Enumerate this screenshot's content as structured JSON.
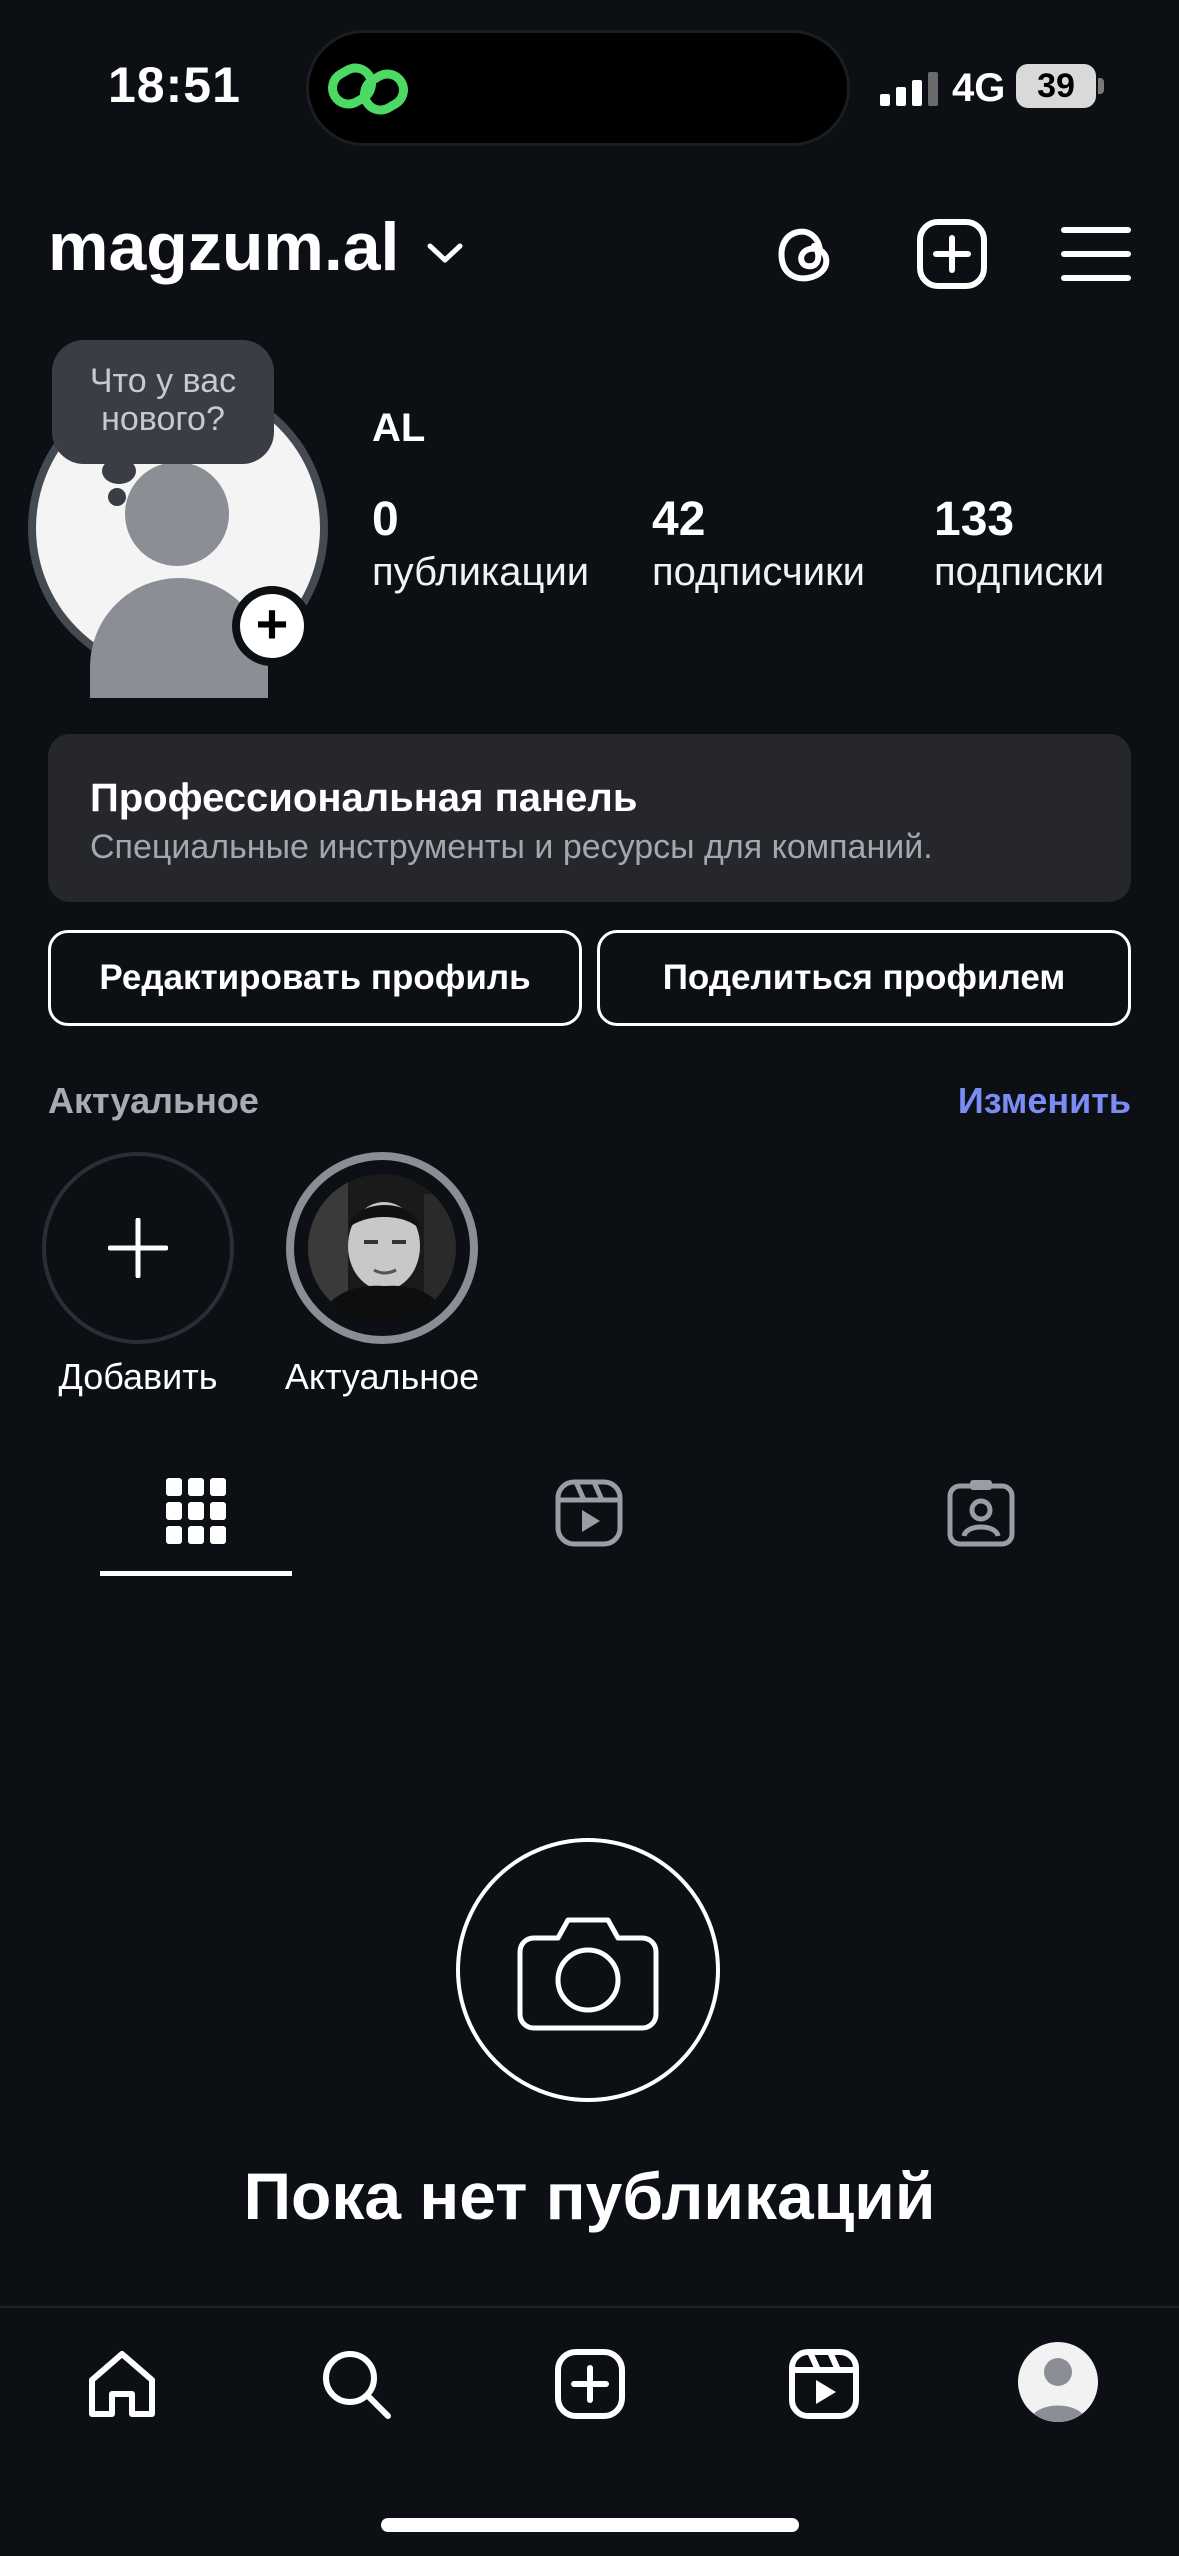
{
  "status_bar": {
    "time": "18:51",
    "network": "4G",
    "battery": "39"
  },
  "header": {
    "username": "magzum.al"
  },
  "profile": {
    "note_bubble": "Что у вас нового?",
    "display_name": "AL",
    "stats": [
      {
        "value": "0",
        "label": "публикации"
      },
      {
        "value": "42",
        "label": "подписчики"
      },
      {
        "value": "133",
        "label": "подписки"
      }
    ]
  },
  "pro_panel": {
    "title": "Профессиональная панель",
    "subtitle": "Специальные инструменты и ресурсы для компаний."
  },
  "buttons": {
    "edit": "Редактировать профиль",
    "share": "Поделиться профилем"
  },
  "highlights": {
    "title": "Актуальное",
    "edit": "Изменить",
    "items": [
      {
        "label": "Добавить"
      },
      {
        "label": "Актуальное"
      }
    ]
  },
  "empty_state": {
    "title": "Пока нет публикаций"
  },
  "colors": {
    "background": "#0c0f14",
    "accent_link": "#7b8cf4",
    "threads_green": "#4cd964"
  }
}
